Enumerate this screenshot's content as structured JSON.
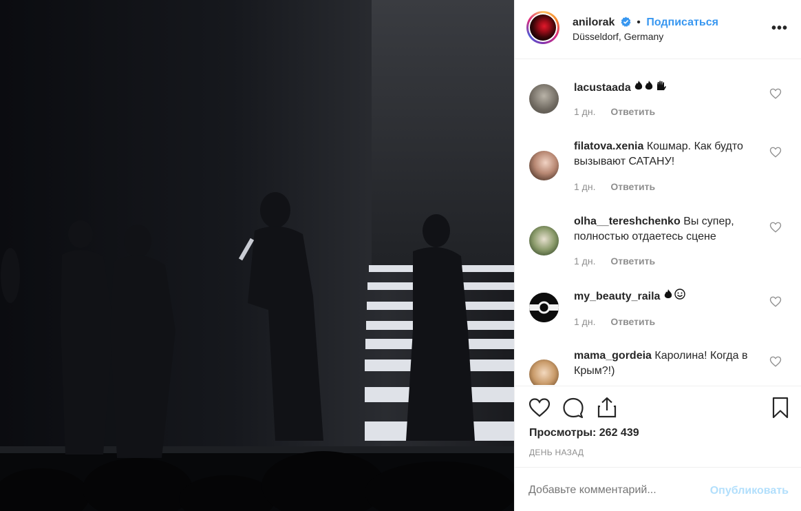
{
  "post": {
    "owner": "anilorak",
    "follow_label": "Подписаться",
    "separator": "•",
    "location": "Düsseldorf, Germany",
    "more_icon": "more-horizontal-icon",
    "more_label": "•••"
  },
  "comments": [
    {
      "user": "lacustaada",
      "text": "",
      "emoji": "fire-fire-hand",
      "age": "1 дн.",
      "reply": "Ответить"
    },
    {
      "user": "filatova.xenia",
      "text": "Кошмар. Как будто вызывают САТАНУ!",
      "age": "1 дн.",
      "reply": "Ответить"
    },
    {
      "user": "olha__tereshchenko",
      "text": "Вы супер, полностью отдаетесь сцене",
      "age": "1 дн.",
      "reply": "Ответить"
    },
    {
      "user": "my_beauty_raila",
      "text": "",
      "emoji": "fire-smile",
      "age": "1 дн.",
      "reply": "Ответить"
    },
    {
      "user": "mama_gordeia",
      "text": "Каролина! Когда в Крым?!)",
      "age": "",
      "reply": ""
    }
  ],
  "actions": {
    "views_label": "Просмотры: 262 439",
    "time_ago": "ДЕНЬ НАЗАД"
  },
  "add_comment": {
    "placeholder": "Добавьте комментарий...",
    "publish_label": "Опубликовать"
  },
  "colors": {
    "accent": "#3897f0",
    "publish_disabled": "#b2dffc",
    "secondary_text": "#8e8e8e",
    "border": "#efefef"
  }
}
